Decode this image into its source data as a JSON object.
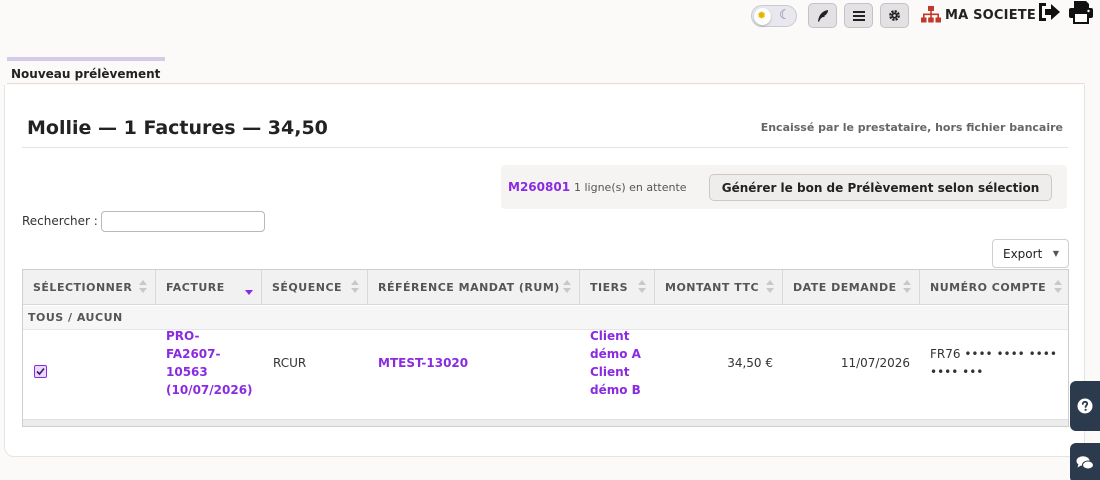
{
  "topbar": {
    "company_label": "MA SOCIETE",
    "icons": [
      "sun-icon",
      "moon-icon",
      "feather-icon",
      "menu-icon",
      "gear-icon",
      "sitemap-icon",
      "logout-icon",
      "printer-icon"
    ]
  },
  "tab": {
    "label": "Nouveau prélèvement"
  },
  "card": {
    "title": "Mollie — 1 Factures — 34,50",
    "subtitle": "Encaissé par le prestataire, hors fichier bancaire"
  },
  "action": {
    "ref": "M260801",
    "pending": "1 ligne(s) en attente",
    "button_label": "Générer le bon de Prélèvement selon sélection"
  },
  "search": {
    "label": "Rechercher :",
    "value": "",
    "placeholder": ""
  },
  "export": {
    "label": "Export"
  },
  "table": {
    "columns": [
      "SÉLECTIONNER",
      "FACTURE",
      "SÉQUENCE",
      "RÉFÉRENCE MANDAT (RUM)",
      "TIERS",
      "MONTANT TTC",
      "DATE DEMANDE",
      "NUMÉRO COMPTE"
    ],
    "select_all": "TOUS / AUCUN",
    "rows": [
      {
        "checked": true,
        "facture_lines": [
          "PRO-",
          "FA2607-",
          "10563",
          "(10/07/2026)"
        ],
        "sequence": "RCUR",
        "rum": "MTEST-13020",
        "tiers_lines": [
          "Client",
          "démo A",
          "Client",
          "démo B"
        ],
        "montant": "34,50 €",
        "date": "11/07/2026",
        "compte_lines": [
          "FR76 •••• •••• ••••",
          "•••• •••"
        ]
      }
    ]
  },
  "colors": {
    "link": "#8a2be2",
    "side_widget": "#2c3a4d"
  }
}
